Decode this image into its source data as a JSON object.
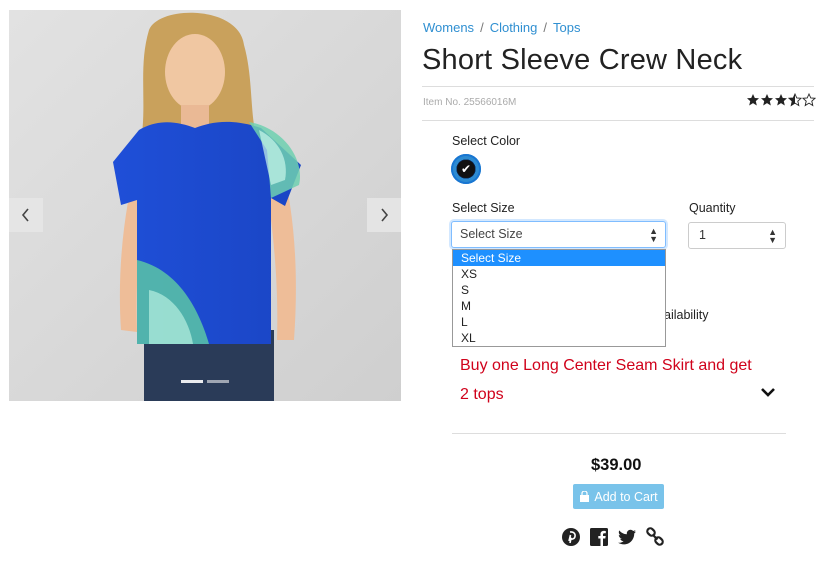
{
  "breadcrumb": [
    "Womens",
    "Clothing",
    "Tops"
  ],
  "product": {
    "title": "Short Sleeve Crew Neck",
    "item_no": "Item No. 25566016M",
    "rating": 3.5,
    "price": "$39.00"
  },
  "color": {
    "label": "Select Color",
    "selected_icon": "check-icon"
  },
  "size": {
    "label": "Select Size",
    "value": "Select Size",
    "options": [
      "Select Size",
      "XS",
      "S",
      "M",
      "L",
      "XL"
    ],
    "highlighted_option": "Select Size"
  },
  "quantity": {
    "label": "Quantity",
    "value": "1"
  },
  "availability_partial": "ailability",
  "promo_text": "Buy one Long Center Seam Skirt and get 2 tops",
  "add_to_cart_label": "Add to Cart",
  "gallery": {
    "prev_icon": "chevron-left-icon",
    "next_icon": "chevron-right-icon",
    "slides": 2,
    "active_slide": 1
  },
  "social_icons": [
    "pinterest-icon",
    "facebook-icon",
    "twitter-icon",
    "link-icon"
  ],
  "colors": {
    "link": "#2f8fd1",
    "promo": "#d0021b",
    "cart_button": "#79c3ea",
    "dropdown_highlight": "#1e90ff"
  }
}
